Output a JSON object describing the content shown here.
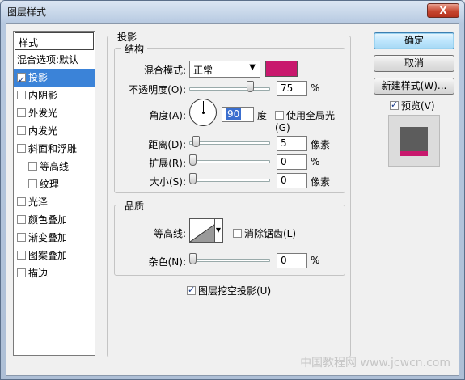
{
  "window": {
    "title": "图层样式",
    "close_label": "X"
  },
  "sidebar": {
    "header": "样式",
    "items": [
      {
        "label": "混合选项:默认",
        "checkbox": false,
        "checked": false,
        "sub": false
      },
      {
        "label": "投影",
        "checkbox": true,
        "checked": true,
        "sub": false
      },
      {
        "label": "内阴影",
        "checkbox": true,
        "checked": false,
        "sub": false
      },
      {
        "label": "外发光",
        "checkbox": true,
        "checked": false,
        "sub": false
      },
      {
        "label": "内发光",
        "checkbox": true,
        "checked": false,
        "sub": false
      },
      {
        "label": "斜面和浮雕",
        "checkbox": true,
        "checked": false,
        "sub": false
      },
      {
        "label": "等高线",
        "checkbox": true,
        "checked": false,
        "sub": true
      },
      {
        "label": "纹理",
        "checkbox": true,
        "checked": false,
        "sub": true
      },
      {
        "label": "光泽",
        "checkbox": true,
        "checked": false,
        "sub": false
      },
      {
        "label": "颜色叠加",
        "checkbox": true,
        "checked": false,
        "sub": false
      },
      {
        "label": "渐变叠加",
        "checkbox": true,
        "checked": false,
        "sub": false
      },
      {
        "label": "图案叠加",
        "checkbox": true,
        "checked": false,
        "sub": false
      },
      {
        "label": "描边",
        "checkbox": true,
        "checked": false,
        "sub": false
      }
    ]
  },
  "shadow": {
    "title": "投影",
    "structure": {
      "title": "结构",
      "blend_mode_label": "混合模式:",
      "blend_mode_value": "正常",
      "color": "#c8186d",
      "opacity_label": "不透明度(O):",
      "opacity_value": "75",
      "opacity_fraction": 0.75,
      "opacity_unit": "%",
      "angle_label": "角度(A):",
      "angle_value": "90",
      "angle_unit": "度",
      "global_light_label": "使用全局光(G)",
      "distance_label": "距离(D):",
      "distance_value": "5",
      "distance_unit": "像素",
      "spread_label": "扩展(R):",
      "spread_value": "0",
      "spread_unit": "%",
      "size_label": "大小(S):",
      "size_value": "0",
      "size_unit": "像素"
    },
    "quality": {
      "title": "品质",
      "contour_label": "等高线:",
      "antialias_label": "消除锯齿(L)",
      "noise_label": "杂色(N):",
      "noise_value": "0",
      "noise_unit": "%"
    },
    "knockout_label": "图层挖空投影(U)"
  },
  "actions": {
    "ok": "确定",
    "cancel": "取消",
    "new_style": "新建样式(W)...",
    "preview_label": "预览(V)"
  },
  "watermark": "中国教程网 www.jcwcn.com"
}
